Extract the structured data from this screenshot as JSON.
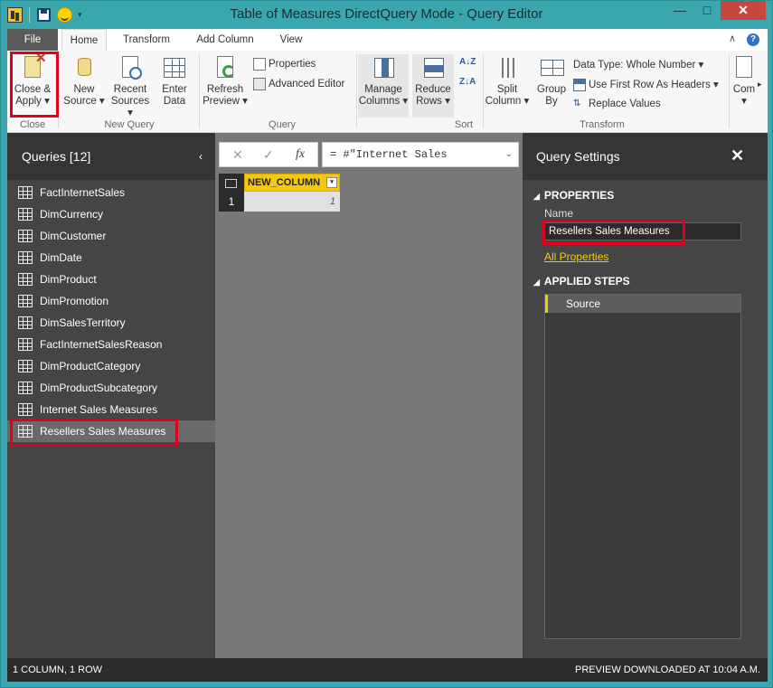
{
  "window": {
    "title": "Table of Measures DirectQuery Mode - Query Editor",
    "min": "—",
    "max": "□",
    "close": "✕"
  },
  "tabs": [
    "File",
    "Home",
    "Transform",
    "Add Column",
    "View"
  ],
  "tab_extras": {
    "collapse": "∧",
    "help": "?"
  },
  "ribbon": {
    "close_apply": [
      "Close &",
      "Apply ▾"
    ],
    "new_source": [
      "New",
      "Source ▾"
    ],
    "recent_sources": [
      "Recent",
      "Sources ▾"
    ],
    "enter_data": [
      "Enter",
      "Data"
    ],
    "refresh_preview": [
      "Refresh",
      "Preview ▾"
    ],
    "properties": "Properties",
    "advanced_editor": "Advanced Editor",
    "manage_columns": [
      "Manage",
      "Columns ▾"
    ],
    "reduce_rows": [
      "Reduce",
      "Rows ▾"
    ],
    "sort_az": "A↓Z",
    "sort_za": "Z↓A",
    "split_column": [
      "Split",
      "Column ▾"
    ],
    "group_by": [
      "Group",
      "By"
    ],
    "data_type": "Data Type: Whole Number ▾",
    "first_row_headers": "Use First Row As Headers ▾",
    "replace_values": "Replace Values",
    "combine": [
      "Com",
      "▾"
    ],
    "groups": {
      "close": "Close",
      "new_query": "New Query",
      "query": "Query",
      "sort": "Sort",
      "transform": "Transform"
    }
  },
  "queries": {
    "title": "Queries [12]",
    "collapse": "‹",
    "items": [
      "FactInternetSales",
      "DimCurrency",
      "DimCustomer",
      "DimDate",
      "DimProduct",
      "DimPromotion",
      "DimSalesTerritory",
      "FactInternetSalesReason",
      "DimProductCategory",
      "DimProductSubcategory",
      "Internet Sales Measures",
      "Resellers Sales Measures"
    ],
    "selected_index": 11
  },
  "formula_bar": {
    "cancel": "✕",
    "confirm": "✓",
    "fx": "fx",
    "formula": "= #\"Internet Sales",
    "expand": "⌄"
  },
  "grid": {
    "column": "NEW_COLUMN",
    "filter": "▾",
    "row_number": "1",
    "value": "1"
  },
  "settings": {
    "title": "Query Settings",
    "close": "✕",
    "properties_header": "PROPERTIES",
    "name_label": "Name",
    "name_value": "Resellers Sales Measures",
    "all_properties": "All Properties",
    "steps_header": "APPLIED STEPS",
    "steps": [
      "Source"
    ]
  },
  "status": {
    "left": "1 COLUMN, 1 ROW",
    "right": "PREVIEW DOWNLOADED AT 10:04 A.M."
  },
  "colors": {
    "titlebar": "#3aa6ad",
    "accent_yellow": "#f2c811",
    "highlight_red": "#e0001b",
    "panel_dark": "#454545"
  }
}
